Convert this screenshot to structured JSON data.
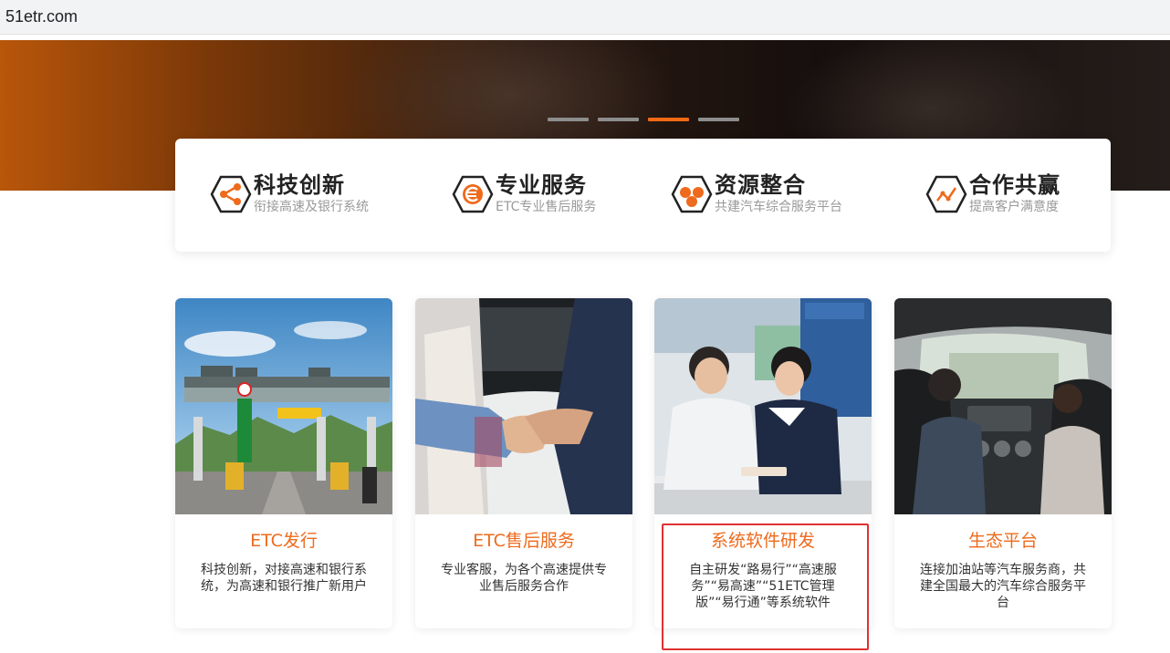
{
  "browser": {
    "url": "51etr.com"
  },
  "banner": {
    "slides": 4,
    "active_slide": 3
  },
  "features": [
    {
      "title": "科技创新",
      "subtitle": "衔接高速及银行系统",
      "icon": "share-nodes-icon"
    },
    {
      "title": "专业服务",
      "subtitle": "ETC专业售后服务",
      "icon": "e-circle-icon"
    },
    {
      "title": "资源整合",
      "subtitle": "共建汽车综合服务平台",
      "icon": "three-circles-icon"
    },
    {
      "title": "合作共赢",
      "subtitle": "提高客户满意度",
      "icon": "trend-line-icon"
    }
  ],
  "cards": [
    {
      "title": "ETC发行",
      "desc": "科技创新，对接高速和银行系统，为高速和银行推广新用户",
      "image": "toll-station-photo"
    },
    {
      "title": "ETC售后服务",
      "desc": "专业客服，为各个高速提供专业售后服务合作",
      "image": "handshake-photo"
    },
    {
      "title": "系统软件研发",
      "desc": "自主研发“路易行”“高速服务”“易高速”“51ETC管理版”“易行通”等系统软件",
      "image": "service-counter-photo"
    },
    {
      "title": "生态平台",
      "desc": "连接加油站等汽车服务商，共建全国最大的汽车综合服务平台",
      "image": "car-interior-photo"
    }
  ],
  "colors": {
    "accent": "#ee6a1c",
    "highlight": "#e03131",
    "banner_dot_active": "#f06a14"
  }
}
